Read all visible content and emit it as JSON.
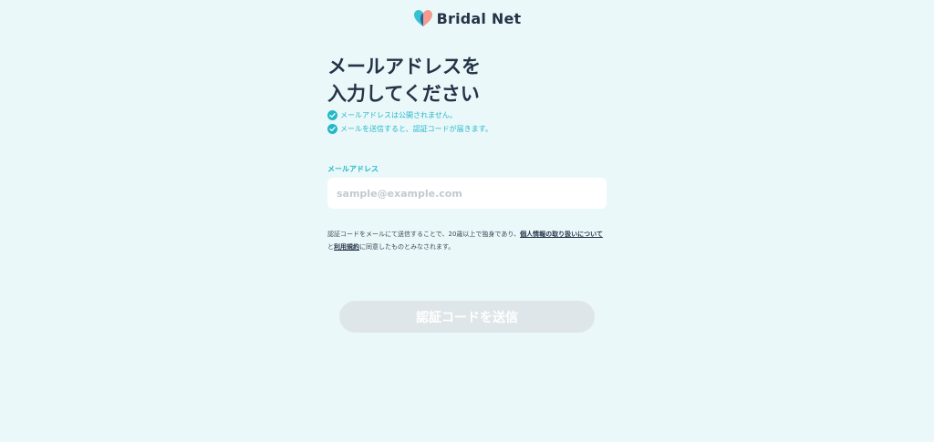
{
  "header": {
    "brand_name": "Bridal Net"
  },
  "main": {
    "title_line_1": "メールアドレスを",
    "title_line_2": "入力してください",
    "notes": [
      "メールアドレスは公開されません。",
      "メールを送信すると、認証コードが届きます。"
    ]
  },
  "form": {
    "email_label": "メールアドレス",
    "email_placeholder": "sample@example.com",
    "email_value": ""
  },
  "consent": {
    "text_before": "認証コードをメールにて送信することで、20歳以上で独身であり、",
    "privacy_link": "個人情報の取り扱いについて",
    "text_middle": "と",
    "terms_link": "利用規約",
    "text_after": "に同意したものとみなされます。"
  },
  "submit": {
    "label": "認証コードを送信",
    "state": "disabled"
  },
  "colors": {
    "background": "#ebf8fa",
    "accent": "#24b8c8",
    "heading": "#243447",
    "button_disabled": "#dfe6e9"
  }
}
